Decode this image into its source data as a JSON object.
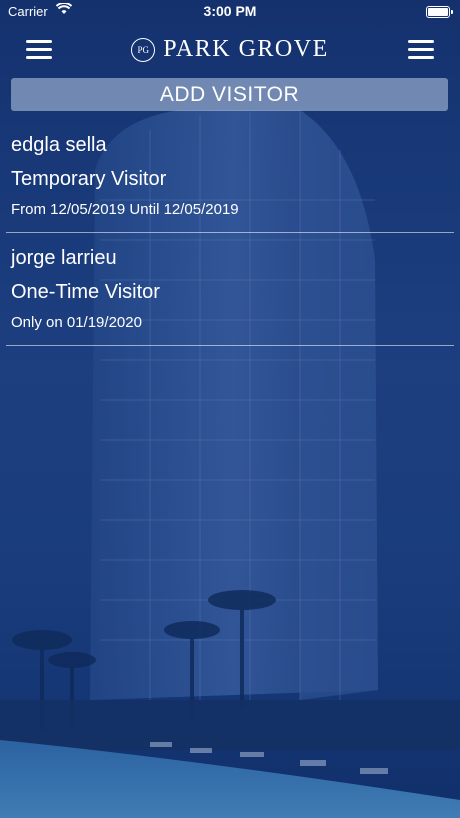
{
  "status_bar": {
    "carrier": "Carrier",
    "time": "3:00 PM"
  },
  "header": {
    "brand_logo_text": "PG",
    "brand_name": "PARK GROVE"
  },
  "actions": {
    "add_visitor_label": "ADD VISITOR"
  },
  "visitors": [
    {
      "name": "edgla sella",
      "type": "Temporary Visitor",
      "dates": "From 12/05/2019 Until 12/05/2019"
    },
    {
      "name": "jorge larrieu",
      "type": "One-Time Visitor",
      "dates": "Only on 01/19/2020"
    }
  ],
  "icons": {
    "menu_left": "hamburger-icon",
    "menu_right": "hamburger-icon",
    "wifi": "wifi-icon",
    "battery": "battery-icon"
  },
  "colors": {
    "background": "#1c3d7e",
    "button": "#bccde6"
  }
}
